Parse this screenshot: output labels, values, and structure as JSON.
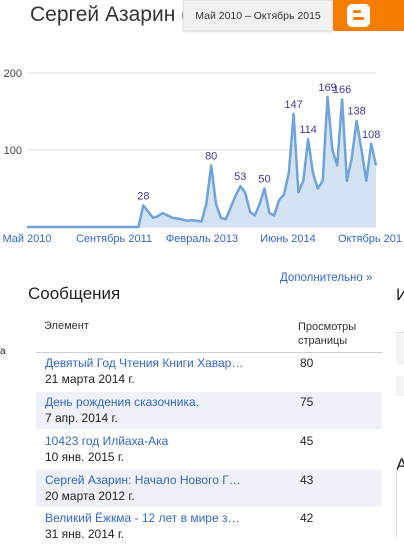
{
  "header": {
    "title": "Сергей Азарин (S",
    "date_range": "Май 2010 – Октябрь 2015"
  },
  "chart_data": {
    "type": "area",
    "y_ticks": [
      "200",
      "100"
    ],
    "ylim": [
      0,
      200
    ],
    "x_tick_labels": [
      "Май 2010",
      "Сентябрь 2011",
      "Февраль 2013",
      "Июнь 2014",
      "Октябрь 201"
    ],
    "values": [
      0,
      0,
      0,
      0,
      0,
      0,
      0,
      0,
      0,
      0,
      0,
      0,
      0,
      0,
      0,
      0,
      0,
      0,
      0,
      0,
      0,
      0,
      0,
      0,
      28,
      20,
      12,
      14,
      18,
      15,
      12,
      11,
      10,
      8,
      9,
      8,
      7,
      30,
      80,
      30,
      12,
      10,
      25,
      40,
      53,
      45,
      20,
      15,
      30,
      50,
      18,
      15,
      35,
      42,
      70,
      147,
      45,
      60,
      114,
      70,
      50,
      60,
      169,
      100,
      80,
      166,
      60,
      90,
      138,
      100,
      60,
      108,
      80
    ],
    "point_labels": [
      {
        "index": 24,
        "label": "28"
      },
      {
        "index": 38,
        "label": "80"
      },
      {
        "index": 44,
        "label": "53"
      },
      {
        "index": 49,
        "label": "50"
      },
      {
        "index": 55,
        "label": "147"
      },
      {
        "index": 58,
        "label": "114"
      },
      {
        "index": 62,
        "label": "169"
      },
      {
        "index": 65,
        "label": "166"
      },
      {
        "index": 68,
        "label": "138"
      },
      {
        "index": 71,
        "label": "108"
      }
    ],
    "grid": true,
    "colors": {
      "line": "#6fa3dc",
      "fill": "#cfe0f3",
      "label": "#3c3ca8"
    }
  },
  "more_link": "Дополнительно »",
  "section": {
    "title": "Сообщения",
    "right_fragment_1": "И",
    "right_fragment_2": "А",
    "left_fragment": "а"
  },
  "table": {
    "col_item": "Элемент",
    "col_views_line1": "Просмотры",
    "col_views_line2": "страницы",
    "rows": [
      {
        "title": "Девятый Год Чтения Книги Хавар…",
        "date": "21 марта 2014 г.",
        "views": "80"
      },
      {
        "title": "День рождения сказочника.",
        "date": "7 апр. 2014 г.",
        "views": "75"
      },
      {
        "title": "10423 год Илйаха-Ака",
        "date": "10 янв. 2015 г.",
        "views": "45"
      },
      {
        "title": "Сергей Азарин: Начало Нового Г…",
        "date": "20 марта 2012 г.",
        "views": "43"
      },
      {
        "title": "Великий Ёжкма - 12 лет в мире з…",
        "date": "31 янв. 2014 г.",
        "views": "42"
      }
    ]
  }
}
